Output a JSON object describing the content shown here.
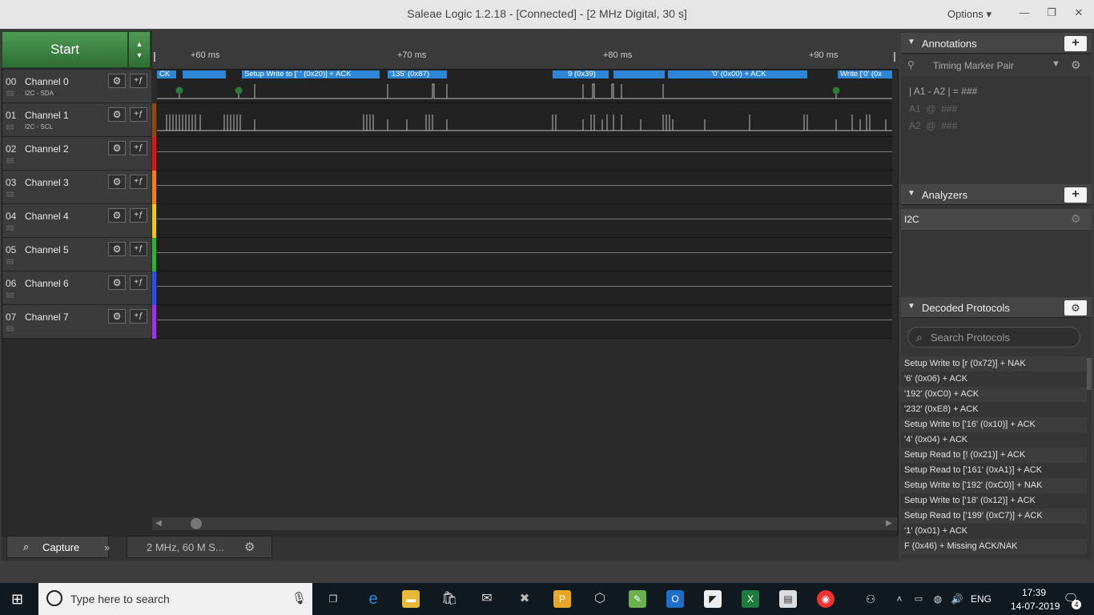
{
  "window": {
    "title": "Saleae Logic 1.2.18 - [Connected] - [2 MHz Digital, 30 s]",
    "options": "Options"
  },
  "start": {
    "label": "Start"
  },
  "ruler": {
    "ticks": [
      "+60 ms",
      "+70 ms",
      "+80 ms",
      "+90 ms"
    ]
  },
  "channels": [
    {
      "num": "00",
      "name": "Channel 0",
      "sub": "I2C - SDA",
      "color": "#2a2a2a"
    },
    {
      "num": "01",
      "name": "Channel 1",
      "sub": "I2C - SCL",
      "color": "#8b4a1c"
    },
    {
      "num": "02",
      "name": "Channel 2",
      "sub": "",
      "color": "#c81e1e"
    },
    {
      "num": "03",
      "name": "Channel 3",
      "sub": "",
      "color": "#e8821e"
    },
    {
      "num": "04",
      "name": "Channel 4",
      "sub": "",
      "color": "#e8c81e"
    },
    {
      "num": "05",
      "name": "Channel 5",
      "sub": "",
      "color": "#3aa83a"
    },
    {
      "num": "06",
      "name": "Channel 6",
      "sub": "",
      "color": "#2e4fd6"
    },
    {
      "num": "07",
      "name": "Channel 7",
      "sub": "",
      "color": "#9a3ad6"
    }
  ],
  "protocol_bubbles": [
    "CK",
    "",
    "Setup Write to [' ' (0x20)] + ACK",
    "'135' (0x87)",
    "9 (0x39)",
    "",
    "'0' (0x00) + ACK",
    "Write ['0' (0x"
  ],
  "bottom": {
    "capture": "Capture",
    "settings": "2 MHz, 60 M S..."
  },
  "annotations": {
    "title": "Annotations",
    "marker": "Timing Marker Pair",
    "row1": "| A1 - A2 | = ###",
    "row2_label": "A1",
    "row2_at": "@",
    "row2_val": "###",
    "row3_label": "A2",
    "row3_at": "@",
    "row3_val": "###"
  },
  "analyzers": {
    "title": "Analyzers",
    "items": [
      "I2C"
    ]
  },
  "decoded": {
    "title": "Decoded Protocols",
    "search_placeholder": "Search Protocols",
    "items": [
      "Setup Write to [r (0x72)] + NAK",
      "'6' (0x06) + ACK",
      "'192' (0xC0) + ACK",
      "'232' (0xE8) + ACK",
      "Setup Write to ['16' (0x10)] + ACK",
      "'4' (0x04) + ACK",
      "Setup Read to [! (0x21)] + ACK",
      "Setup Read to ['161' (0xA1)] + ACK",
      "Setup Write to ['192' (0xC0)] + NAK",
      "Setup Write to ['18' (0x12)] + ACK",
      "Setup Read to ['199' (0xC7)] + ACK",
      "'1' (0x01) + ACK",
      "F (0x46) + Missing ACK/NAK"
    ]
  },
  "taskbar": {
    "search": "Type here to search",
    "lang": "ENG",
    "time": "17:39",
    "date": "14-07-2019",
    "notifications": "4"
  }
}
